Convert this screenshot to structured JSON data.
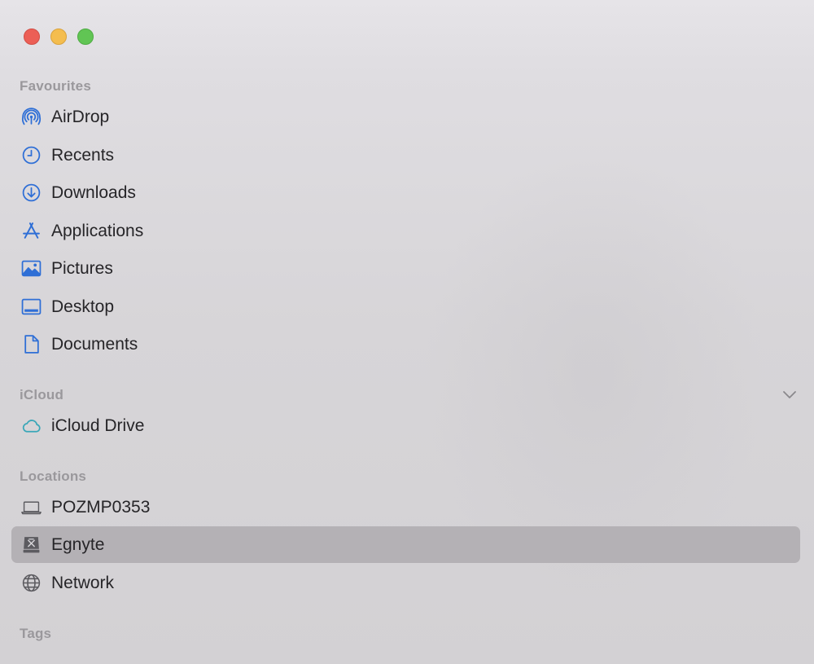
{
  "sections": {
    "favourites": "Favourites",
    "icloud": "iCloud",
    "locations": "Locations",
    "tags": "Tags"
  },
  "favourites": [
    {
      "label": "AirDrop",
      "icon": "airdrop-icon"
    },
    {
      "label": "Recents",
      "icon": "clock-icon"
    },
    {
      "label": "Downloads",
      "icon": "download-icon"
    },
    {
      "label": "Applications",
      "icon": "applications-icon"
    },
    {
      "label": "Pictures",
      "icon": "picture-icon"
    },
    {
      "label": "Desktop",
      "icon": "desktop-icon"
    },
    {
      "label": "Documents",
      "icon": "document-icon"
    }
  ],
  "icloud": [
    {
      "label": "iCloud Drive",
      "icon": "cloud-icon"
    }
  ],
  "locations": [
    {
      "label": "POZMP0353",
      "icon": "laptop-icon"
    },
    {
      "label": "Egnyte",
      "icon": "external-drive-icon",
      "selected": true
    },
    {
      "label": "Network",
      "icon": "globe-icon"
    }
  ],
  "colors": {
    "accent_blue": "#2f6fd6",
    "icloud_teal": "#3aa7b8",
    "gray_icon": "#5c5b60",
    "selection": "#b4b1b5",
    "section_header": "#9a989c",
    "close": "#ec5f56",
    "minimize": "#f4bd4f",
    "maximize": "#61c554"
  }
}
